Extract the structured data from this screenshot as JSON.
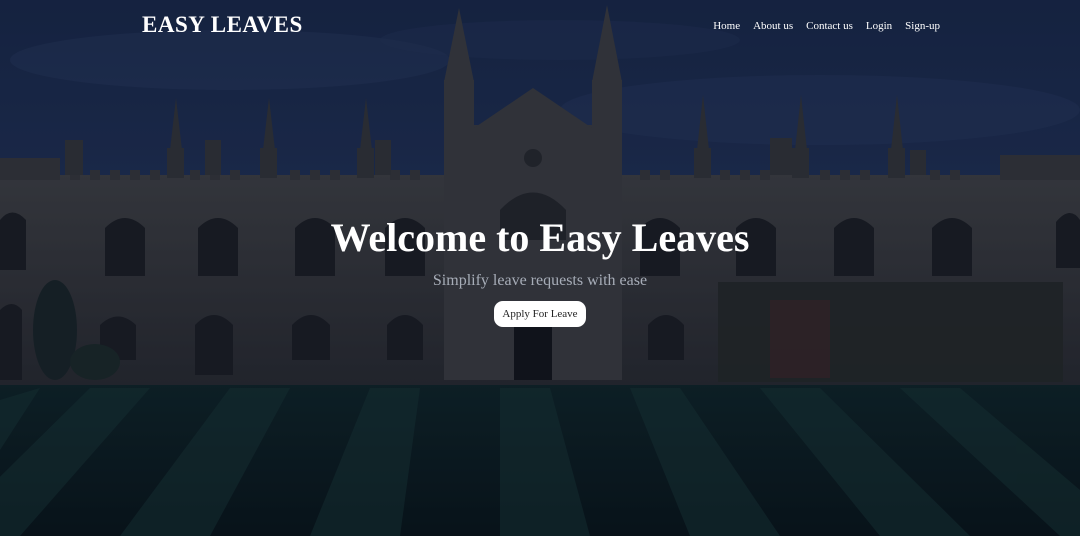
{
  "brand": {
    "name": "EASY LEAVES"
  },
  "nav": {
    "items": [
      {
        "label": "Home"
      },
      {
        "label": "About us"
      },
      {
        "label": "Contact us"
      },
      {
        "label": "Login"
      },
      {
        "label": "Sign-up"
      }
    ]
  },
  "hero": {
    "title": "Welcome to Easy Leaves",
    "subtitle": "Simplify leave requests with ease",
    "cta_label": "Apply For Leave"
  },
  "colors": {
    "sky": "#1d2c4d",
    "stone": "#3b3936",
    "lawn_dark": "#0c1a17",
    "lawn_light": "#16302a",
    "text": "#ffffff",
    "subtitle": "#a7adb8",
    "button_bg": "#ffffff"
  }
}
